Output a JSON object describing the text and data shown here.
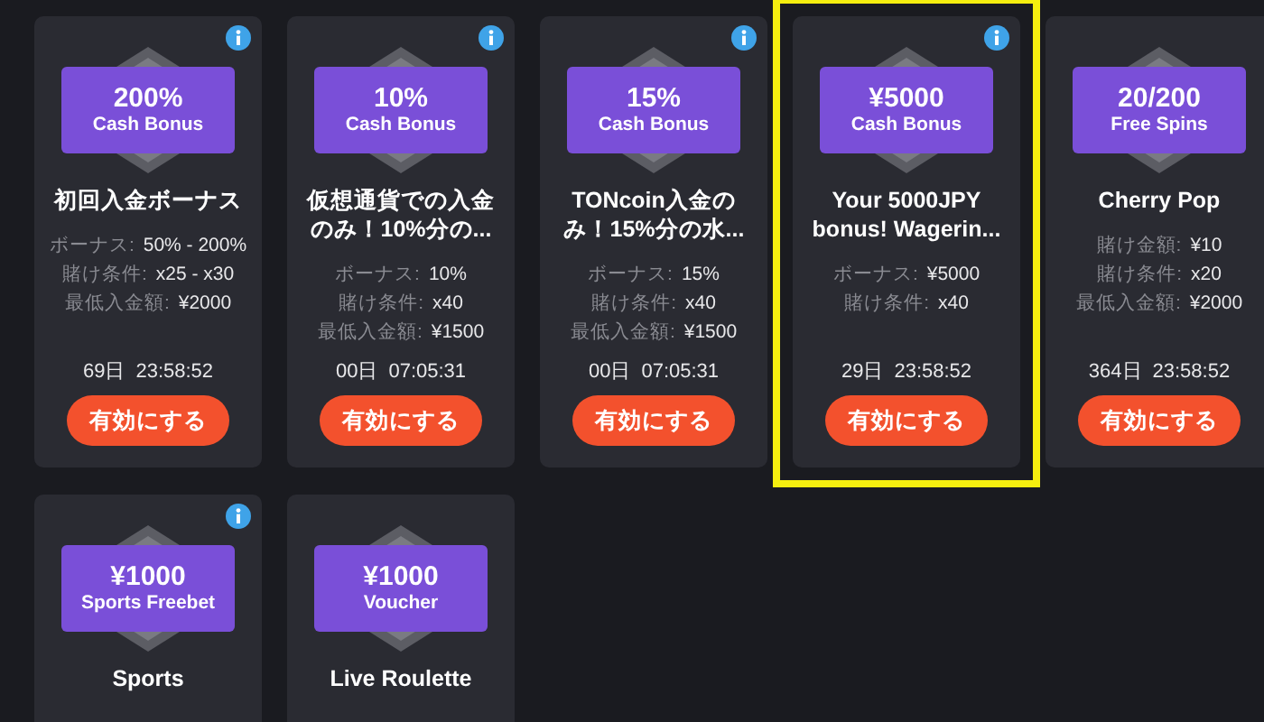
{
  "bonuses": [
    {
      "amount": "200%",
      "type": "Cash Bonus",
      "info": true,
      "selected": false,
      "title": "初回入金ボーナス",
      "details": [
        {
          "label": "ボーナス:",
          "value": "50% - 200%"
        },
        {
          "label": "賭け条件:",
          "value": "x25 - x30"
        },
        {
          "label": "最低入金額:",
          "value": "¥2000"
        }
      ],
      "days": "69日",
      "time": "23:58:52",
      "button": "有効にする"
    },
    {
      "amount": "10%",
      "type": "Cash Bonus",
      "info": true,
      "selected": false,
      "title": "仮想通貨での入金のみ！10%分の...",
      "details": [
        {
          "label": "ボーナス:",
          "value": "10%"
        },
        {
          "label": "賭け条件:",
          "value": "x40"
        },
        {
          "label": "最低入金額:",
          "value": "¥1500"
        }
      ],
      "days": "00日",
      "time": "07:05:31",
      "button": "有効にする"
    },
    {
      "amount": "15%",
      "type": "Cash Bonus",
      "info": true,
      "selected": false,
      "title": "TONcoin入金のみ！15%分の水...",
      "details": [
        {
          "label": "ボーナス:",
          "value": "15%"
        },
        {
          "label": "賭け条件:",
          "value": "x40"
        },
        {
          "label": "最低入金額:",
          "value": "¥1500"
        }
      ],
      "days": "00日",
      "time": "07:05:31",
      "button": "有効にする"
    },
    {
      "amount": "¥5000",
      "type": "Cash Bonus",
      "info": true,
      "selected": true,
      "title": "Your 5000JPY bonus! Wagerin...",
      "details": [
        {
          "label": "ボーナス:",
          "value": "¥5000"
        },
        {
          "label": "賭け条件:",
          "value": "x40"
        }
      ],
      "days": "29日",
      "time": "23:58:52",
      "button": "有効にする"
    },
    {
      "amount": "20/200",
      "type": "Free Spins",
      "info": false,
      "selected": false,
      "title": "Cherry Pop",
      "details": [
        {
          "label": "賭け金額:",
          "value": "¥10"
        },
        {
          "label": "賭け条件:",
          "value": "x20"
        },
        {
          "label": "最低入金額:",
          "value": "¥2000"
        }
      ],
      "days": "364日",
      "time": "23:58:52",
      "button": "有効にする"
    },
    {
      "amount": "¥1000",
      "type": "Sports Freebet",
      "info": true,
      "selected": false,
      "title": "Sports"
    },
    {
      "amount": "¥1000",
      "type": "Voucher",
      "info": false,
      "selected": false,
      "title": "Live Roulette"
    }
  ]
}
